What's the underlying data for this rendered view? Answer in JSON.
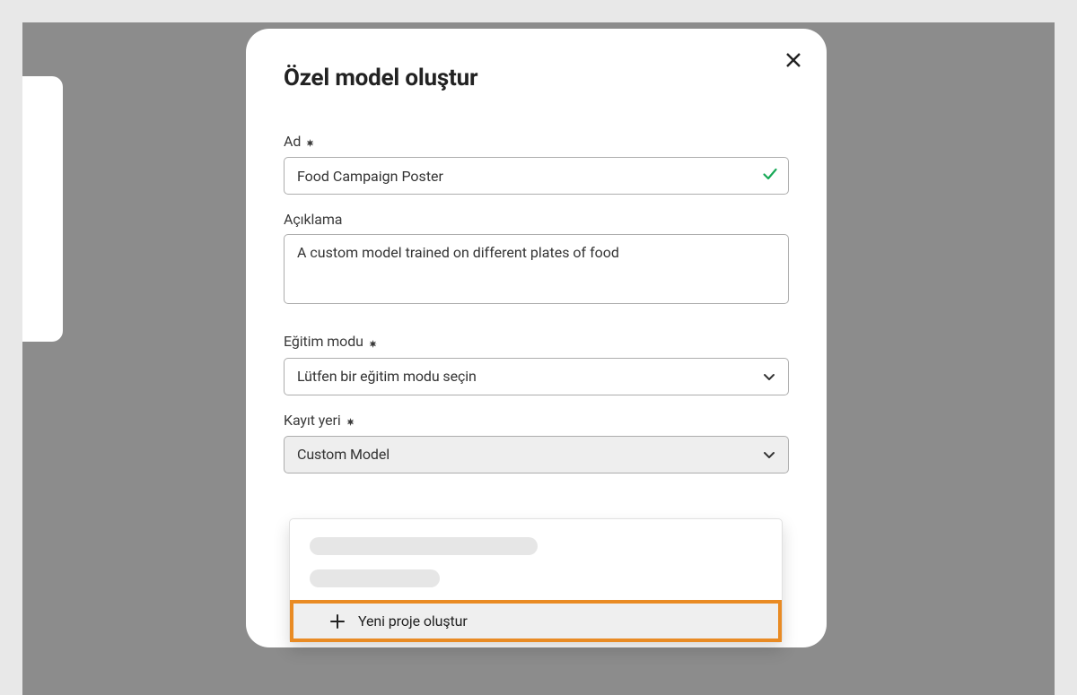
{
  "dialog": {
    "title": "Özel model oluştur",
    "close_label": "Kapat"
  },
  "fields": {
    "name_label": "Ad",
    "name_value": "Food Campaign Poster",
    "desc_label": "Açıklama",
    "desc_value": "A custom model trained on different plates of food",
    "mode_label": "Eğitim modu",
    "mode_placeholder": "Lütfen bir eğitim modu seçin",
    "save_label": "Kayıt yeri",
    "save_value": "Custom Model"
  },
  "dropdown": {
    "new_project": "Yeni proje oluştur"
  }
}
